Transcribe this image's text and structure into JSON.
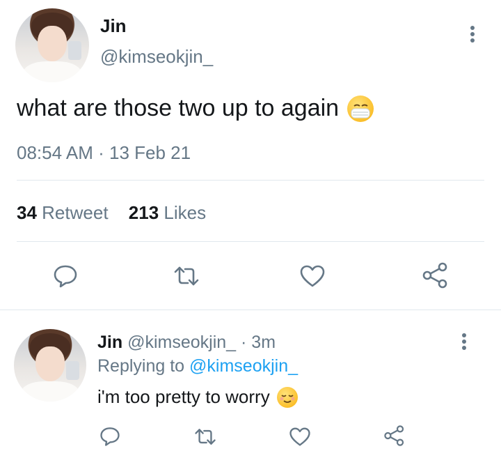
{
  "tweet": {
    "display_name": "Jin",
    "handle": "@kimseokjin_",
    "text": "what are those two up to again",
    "emoji": "mask-face-emoji",
    "time": "08:54 AM",
    "separator": "·",
    "date": "13 Feb 21",
    "retweet_count": "34",
    "retweet_label": "Retweet",
    "likes_count": "213",
    "likes_label": "Likes"
  },
  "reply": {
    "display_name": "Jin",
    "handle": "@kimseokjin_",
    "separator": "·",
    "age": "3m",
    "replying_to_label": "Replying to",
    "replying_to_handle": "@kimseokjin_",
    "text": "i'm too pretty to worry",
    "emoji": "relieved-face-emoji"
  },
  "colors": {
    "muted": "#657786",
    "link": "#1da1f2",
    "divider": "#e1e8ed",
    "text": "#14171a"
  },
  "icons": [
    "reply-icon",
    "retweet-icon",
    "like-icon",
    "share-icon",
    "more-options-icon"
  ]
}
